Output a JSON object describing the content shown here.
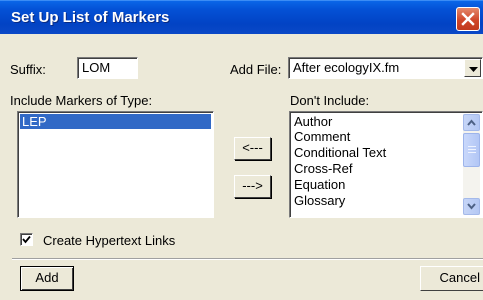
{
  "window": {
    "title": "Set Up List of Markers"
  },
  "suffix": {
    "label": "Suffix:",
    "value": "LOM"
  },
  "add_file": {
    "label": "Add File:",
    "value": "After ecologyIX.fm"
  },
  "include": {
    "label": "Include Markers of Type:",
    "items": [
      "LEP"
    ],
    "selected": "LEP"
  },
  "exclude": {
    "label": "Don't Include:",
    "items": [
      "Author",
      "Comment",
      "Conditional Text",
      "Cross-Ref",
      "Equation",
      "Glossary"
    ]
  },
  "move_buttons": {
    "move_left": "<---",
    "move_right": "--->"
  },
  "hypertext": {
    "label": "Create Hypertext Links",
    "checked": true
  },
  "footer": {
    "add_label": "Add",
    "cancel_label": "Cancel"
  },
  "icons": {
    "close": "close-icon",
    "dropdown": "chevron-down-icon",
    "scroll_up": "arrow-up-icon",
    "scroll_down": "arrow-down-icon",
    "check": "check-icon"
  },
  "colors": {
    "titlebar": "#0451d6",
    "close_button": "#d0472a",
    "selection": "#3169c6",
    "dialog_bg": "#ece9d8"
  }
}
